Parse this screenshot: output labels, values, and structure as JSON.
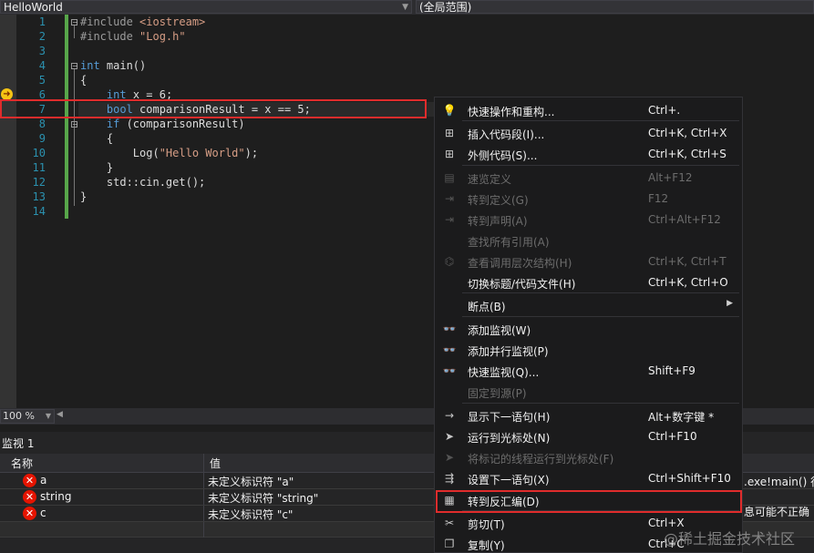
{
  "editor": {
    "file_combo": "HelloWorld",
    "scope_combo": "(全局范围)",
    "line_numbers": [
      "1",
      "2",
      "3",
      "4",
      "5",
      "6",
      "7",
      "8",
      "9",
      "10",
      "11",
      "12",
      "13",
      "14"
    ],
    "lines": [
      {
        "segments": [
          {
            "t": "#include ",
            "c": "pp"
          },
          {
            "t": "<iostream>",
            "c": "str"
          }
        ]
      },
      {
        "segments": [
          {
            "t": "#include ",
            "c": "pp"
          },
          {
            "t": "\"Log.h\"",
            "c": "str"
          }
        ]
      },
      {
        "segments": []
      },
      {
        "segments": [
          {
            "t": "int",
            "c": "kw"
          },
          {
            "t": " main()",
            "c": ""
          }
        ]
      },
      {
        "segments": [
          {
            "t": "{",
            "c": ""
          }
        ]
      },
      {
        "segments": [
          {
            "t": "    ",
            "c": ""
          },
          {
            "t": "int",
            "c": "kw"
          },
          {
            "t": " x = 6;",
            "c": ""
          }
        ]
      },
      {
        "segments": [
          {
            "t": "    ",
            "c": ""
          },
          {
            "t": "bool",
            "c": "kw"
          },
          {
            "t": " comparisonResult = x == 5;",
            "c": ""
          }
        ]
      },
      {
        "segments": [
          {
            "t": "    ",
            "c": ""
          },
          {
            "t": "if",
            "c": "kw"
          },
          {
            "t": " (comparisonResult)",
            "c": ""
          }
        ]
      },
      {
        "segments": [
          {
            "t": "    {",
            "c": ""
          }
        ]
      },
      {
        "segments": [
          {
            "t": "        Log(",
            "c": ""
          },
          {
            "t": "\"Hello World\"",
            "c": "str"
          },
          {
            "t": ");",
            "c": ""
          }
        ]
      },
      {
        "segments": [
          {
            "t": "    }",
            "c": ""
          }
        ]
      },
      {
        "segments": [
          {
            "t": "    std::cin.get();",
            "c": ""
          }
        ]
      },
      {
        "segments": [
          {
            "t": "}",
            "c": ""
          }
        ]
      },
      {
        "segments": []
      }
    ]
  },
  "status": {
    "zoom": "100 %"
  },
  "watch": {
    "title": "监视 1",
    "col_name": "名称",
    "col_value": "值",
    "rows": [
      {
        "name": "a",
        "value": "未定义标识符 \"a\""
      },
      {
        "name": "string",
        "value": "未定义标识符 \"string\""
      },
      {
        "name": "c",
        "value": "未定义标识符 \"c\""
      }
    ],
    "right_fragment_1": ".exe!main() 行",
    "right_fragment_2": "息可能不正确"
  },
  "context_menu": {
    "items": [
      {
        "label": "快速操作和重构...",
        "shortcut": "Ctrl+.",
        "icon": "lightbulb-icon",
        "glyph": "💡",
        "disabled": false
      },
      {
        "label": "插入代码段(I)...",
        "shortcut": "Ctrl+K, Ctrl+X",
        "icon": "insert-snippet-icon",
        "glyph": "⊞",
        "disabled": false
      },
      {
        "label": "外侧代码(S)...",
        "shortcut": "Ctrl+K, Ctrl+S",
        "icon": "surround-with-icon",
        "glyph": "⊞",
        "disabled": false
      },
      {
        "label": "速览定义",
        "shortcut": "Alt+F12",
        "icon": "peek-definition-icon",
        "glyph": "▤",
        "disabled": true
      },
      {
        "label": "转到定义(G)",
        "shortcut": "F12",
        "icon": "go-to-definition-icon",
        "glyph": "⇥",
        "disabled": true
      },
      {
        "label": "转到声明(A)",
        "shortcut": "Ctrl+Alt+F12",
        "icon": "go-to-declaration-icon",
        "glyph": "⇥",
        "disabled": true
      },
      {
        "label": "查找所有引用(A)",
        "shortcut": "",
        "icon": "",
        "glyph": "",
        "disabled": true
      },
      {
        "label": "查看调用层次结构(H)",
        "shortcut": "Ctrl+K, Ctrl+T",
        "icon": "call-hierarchy-icon",
        "glyph": "⌬",
        "disabled": true
      },
      {
        "label": "切换标题/代码文件(H)",
        "shortcut": "Ctrl+K, Ctrl+O",
        "icon": "",
        "glyph": "",
        "disabled": false
      },
      {
        "label": "断点(B)",
        "shortcut": "",
        "icon": "",
        "glyph": "",
        "disabled": false,
        "submenu": true
      },
      {
        "label": "添加监视(W)",
        "shortcut": "",
        "icon": "add-watch-icon",
        "glyph": "👓",
        "disabled": false
      },
      {
        "label": "添加并行监视(P)",
        "shortcut": "",
        "icon": "add-parallel-watch-icon",
        "glyph": "👓",
        "disabled": false
      },
      {
        "label": "快速监视(Q)...",
        "shortcut": "Shift+F9",
        "icon": "quick-watch-icon",
        "glyph": "👓",
        "disabled": false
      },
      {
        "label": "固定到源(P)",
        "shortcut": "",
        "icon": "",
        "glyph": "",
        "disabled": true
      },
      {
        "label": "显示下一语句(H)",
        "shortcut": "Alt+数字键 *",
        "icon": "show-next-statement-icon",
        "glyph": "→",
        "disabled": false
      },
      {
        "label": "运行到光标处(N)",
        "shortcut": "Ctrl+F10",
        "icon": "run-to-cursor-icon",
        "glyph": "➤",
        "disabled": false
      },
      {
        "label": "将标记的线程运行到光标处(F)",
        "shortcut": "",
        "icon": "run-flagged-threads-icon",
        "glyph": "➤",
        "disabled": true
      },
      {
        "label": "设置下一语句(X)",
        "shortcut": "Ctrl+Shift+F10",
        "icon": "set-next-statement-icon",
        "glyph": "⇶",
        "disabled": false
      },
      {
        "label": "转到反汇编(D)",
        "shortcut": "",
        "icon": "go-to-disassembly-icon",
        "glyph": "▦",
        "disabled": false
      },
      {
        "label": "剪切(T)",
        "shortcut": "Ctrl+X",
        "icon": "cut-icon",
        "glyph": "✂",
        "disabled": false
      },
      {
        "label": "复制(Y)",
        "shortcut": "Ctrl+C",
        "icon": "copy-icon",
        "glyph": "❐",
        "disabled": false
      }
    ]
  },
  "watermark": "@稀土掘金技术社区"
}
